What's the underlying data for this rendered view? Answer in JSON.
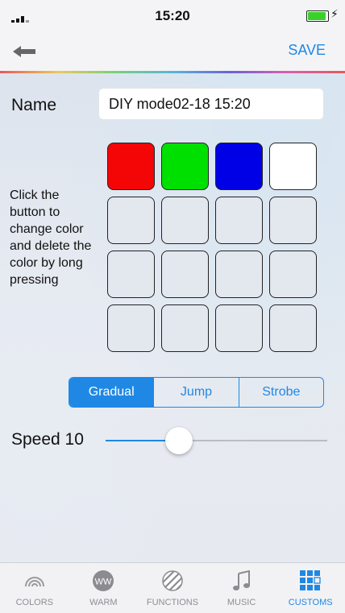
{
  "status_bar": {
    "time": "15:20"
  },
  "nav": {
    "save_label": "SAVE"
  },
  "form": {
    "name_label": "Name",
    "name_value": "DIY mode02-18 15:20",
    "instructions": "Click the button to change color and delete the color by long pressing"
  },
  "color_slots": [
    {
      "color": "#f40606"
    },
    {
      "color": "#00e000"
    },
    {
      "color": "#0000e6"
    },
    {
      "color": "#ffffff"
    },
    {
      "color": ""
    },
    {
      "color": ""
    },
    {
      "color": ""
    },
    {
      "color": ""
    },
    {
      "color": ""
    },
    {
      "color": ""
    },
    {
      "color": ""
    },
    {
      "color": ""
    },
    {
      "color": ""
    },
    {
      "color": ""
    },
    {
      "color": ""
    },
    {
      "color": ""
    }
  ],
  "modes": {
    "options": [
      "Gradual",
      "Jump",
      "Strobe"
    ],
    "selected": "Gradual"
  },
  "speed": {
    "label": "Speed 10",
    "fraction": 0.33
  },
  "tabs": [
    {
      "label": "COLORS",
      "icon": "rainbow-icon",
      "active": false
    },
    {
      "label": "WARM",
      "icon": "ww-icon",
      "active": false
    },
    {
      "label": "FUNCTIONS",
      "icon": "functions-icon",
      "active": false
    },
    {
      "label": "MUSIC",
      "icon": "music-note-icon",
      "active": false
    },
    {
      "label": "CUSTOMS",
      "icon": "grid-icon",
      "active": true
    }
  ],
  "colors": {
    "accent": "#1f88e5",
    "empty_slot": "#e3e7ee"
  }
}
